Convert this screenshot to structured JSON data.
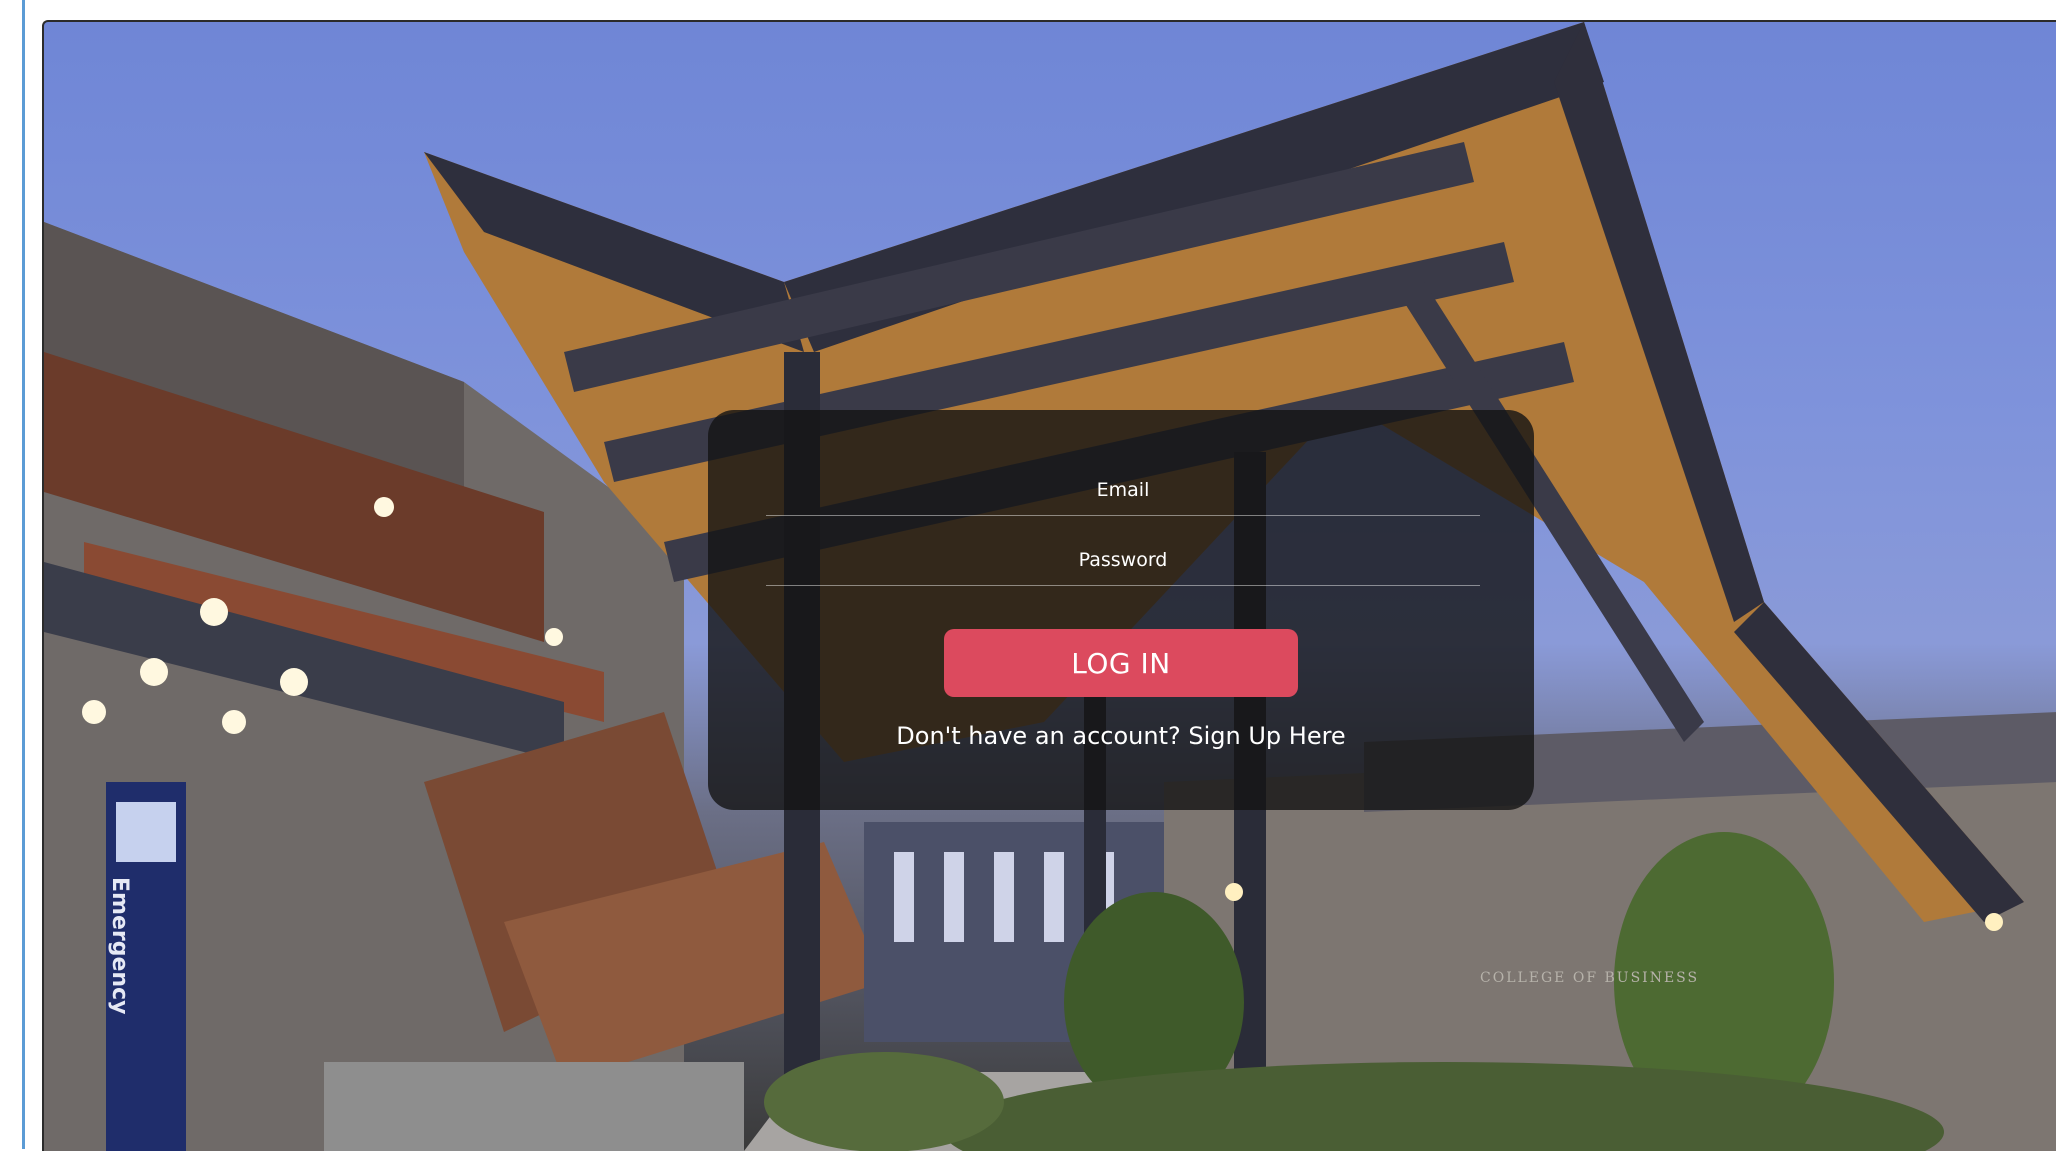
{
  "login": {
    "email_placeholder": "Email",
    "password_placeholder": "Password",
    "login_label": "LOG IN",
    "signup_prompt": "Don't have an account?",
    "signup_link": "Sign Up Here"
  },
  "background": {
    "emergency_sign": "Emergency",
    "building_sign": "COLLEGE OF BUSINESS"
  },
  "colors": {
    "button": "#dc4a5e",
    "card": "#141414",
    "sky": "#7f93db"
  }
}
